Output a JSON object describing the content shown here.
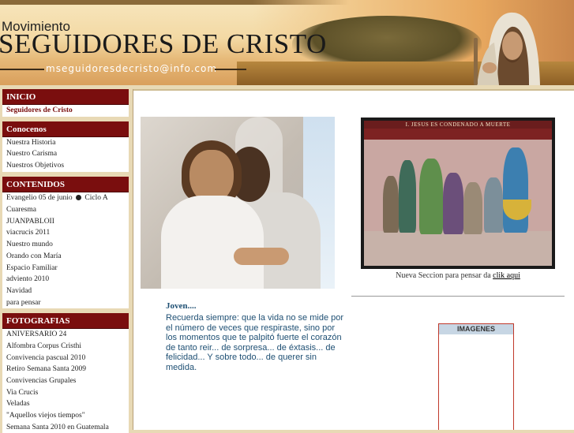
{
  "header": {
    "kicker": "Movimiento",
    "title": "SEGUIDORES DE CRISTO",
    "email": "mseguidoresdecristo@info.com"
  },
  "sidebar": {
    "inicio": {
      "heading": "INICIO",
      "items": [
        "Seguidores de Cristo"
      ]
    },
    "conocenos": {
      "heading": "Conocenos",
      "items": [
        "Nuestra Historia",
        "Nuestro Carisma",
        "Nuestros Objetivos"
      ]
    },
    "contenidos": {
      "heading": "CONTENIDOS",
      "evangelio_a": "Evangelio 05 de junio",
      "evangelio_b": "Ciclo A",
      "evangelio_c": "Cuaresma",
      "items": [
        "JUANPABLOII",
        "viacrucis 2011",
        "Nuestro mundo",
        "Orando con María",
        "Espacio Familiar",
        "adviento 2010",
        "Navidad",
        "para pensar"
      ]
    },
    "fotografias": {
      "heading": "FOTOGRAFIAS",
      "items": [
        "ANIVERSARIO 24",
        "Alfombra Corpus Cristhi",
        "Convivencia pascual 2010",
        "Retiro Semana Santa 2009",
        "Convivencias Grupales",
        "Via Crucis",
        "Veladas",
        "\"Aquellos viejos tiempos\"",
        "Semana Santa 2010 en Guatemala"
      ]
    }
  },
  "main": {
    "comic_banner": "I. JESUS ES CONDENADO A MUERTE",
    "comic_caption_text": "Nueva Seccion para pensar da",
    "comic_link": "clik aqui",
    "quote_title": "Joven....",
    "quote_text": "Recuerda siempre: que la vida no se mide por el número de veces que respiraste, sino por los momentos que te palpitó fuerte el corazón de tanto reir... de sorpresa... de éxtasis... de felicidad... Y sobre todo... de querer sin medida.",
    "images_label": "IMAGENES"
  }
}
